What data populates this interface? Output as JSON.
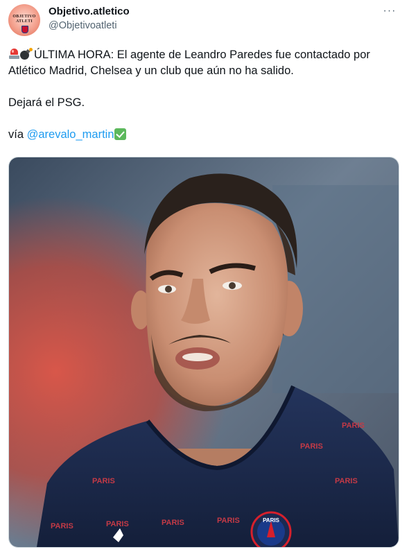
{
  "tweet": {
    "author": {
      "display_name": "Objetivo.atletico",
      "handle": "@Objetivoatleti",
      "avatar_text_line1": "OBJETIVO",
      "avatar_text_line2": "ATLETI"
    },
    "more_label": "···",
    "text": {
      "line1_headline": "ÚLTIMA HORA: El agente de Leandro Paredes fue contactado por",
      "line2": "Atlético Madrid, Chelsea y un club que aún no ha salido.",
      "line3": "Dejará el PSG.",
      "via_prefix": "vía ",
      "via_mention": "@arevalo_martin",
      "emojis": [
        "rotating-light",
        "bomb",
        "check-mark-button"
      ]
    },
    "media": {
      "alt_subject": "player photo",
      "shirt_repeat_text": "PARIS",
      "badge_text": "PARIS",
      "colors": {
        "shirt": "#1a2a4f",
        "badge_red": "#d6202c",
        "background_red": "#c94b3f"
      }
    }
  },
  "colors": {
    "text_primary": "#0f1419",
    "text_secondary": "#536471",
    "link": "#1d9bf0",
    "border": "#cfd9de"
  }
}
